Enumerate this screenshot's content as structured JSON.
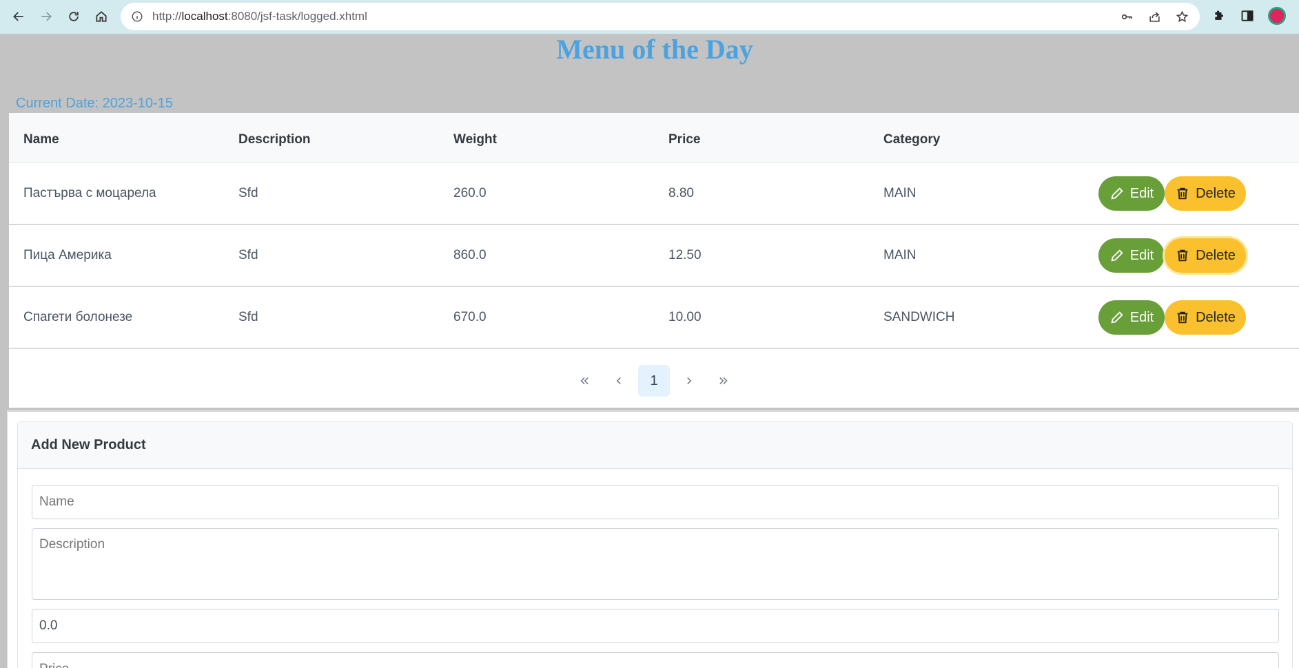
{
  "browser": {
    "url_host": "localhost",
    "url_rest": ":8080/jsf-task/logged.xhtml",
    "url_prefix": "http://"
  },
  "page": {
    "title": "Menu of the Day",
    "current_date": "Current Date: 2023-10-15"
  },
  "table": {
    "headers": [
      "Name",
      "Description",
      "Weight",
      "Price",
      "Category"
    ],
    "rows": [
      {
        "name": "Пастърва с моцарела",
        "description": "Sfd",
        "weight": "260.0",
        "price": "8.80",
        "category": "MAIN"
      },
      {
        "name": "Пица Америка",
        "description": "Sfd",
        "weight": "860.0",
        "price": "12.50",
        "category": "MAIN"
      },
      {
        "name": "Спагети болонезе",
        "description": "Sfd",
        "weight": "670.0",
        "price": "10.00",
        "category": "SANDWICH"
      }
    ],
    "edit_label": "Edit",
    "delete_label": "Delete",
    "current_page": "1"
  },
  "form": {
    "title": "Add New Product",
    "name_placeholder": "Name",
    "description_placeholder": "Description",
    "weight_value": "0.0",
    "price_placeholder": "Price"
  },
  "colors": {
    "accent": "#4aa3e0",
    "edit": "#689f38",
    "delete": "#fbc02d"
  }
}
